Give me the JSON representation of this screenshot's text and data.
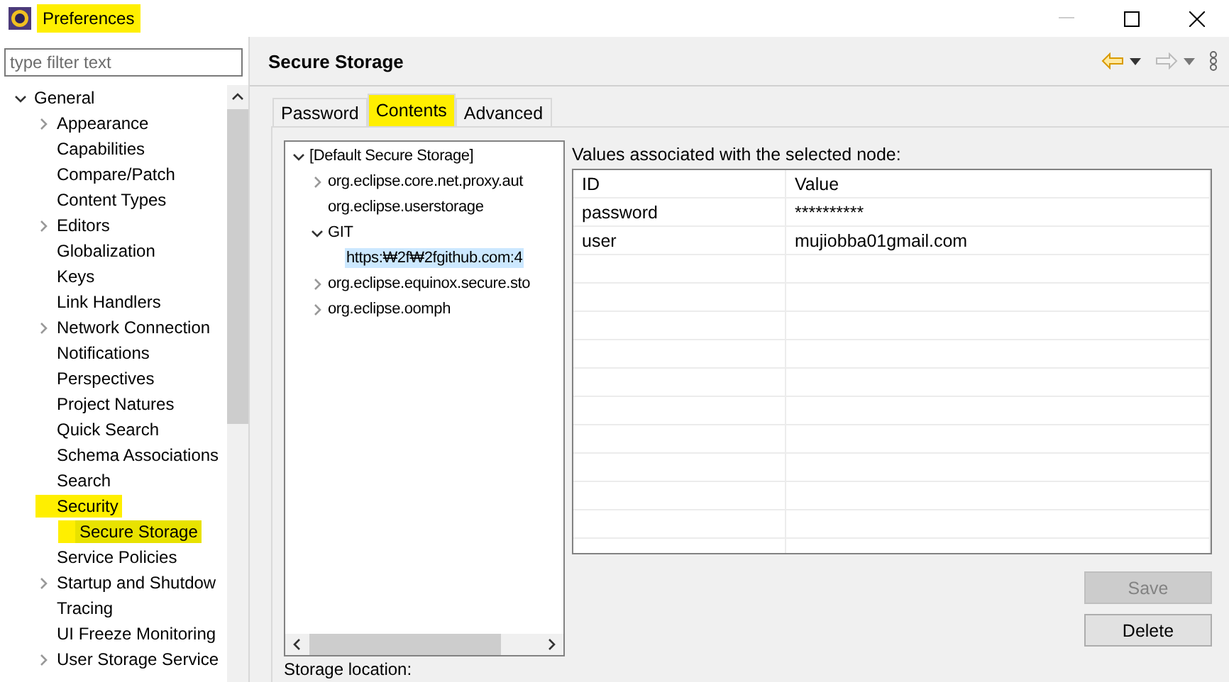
{
  "window": {
    "title": "Preferences",
    "title_highlighted": true
  },
  "filter": {
    "placeholder": "type filter text"
  },
  "nav_tree": [
    {
      "label": "General",
      "expanded": true,
      "selected": false,
      "highlighted": false,
      "children": [
        {
          "label": "Appearance",
          "expanded": false,
          "selected": false,
          "highlighted": false
        },
        {
          "label": "Capabilities",
          "selected": false,
          "highlighted": false
        },
        {
          "label": "Compare/Patch",
          "selected": false,
          "highlighted": false
        },
        {
          "label": "Content Types",
          "selected": false,
          "highlighted": false
        },
        {
          "label": "Editors",
          "expanded": false,
          "selected": false,
          "highlighted": false
        },
        {
          "label": "Globalization",
          "selected": false,
          "highlighted": false
        },
        {
          "label": "Keys",
          "selected": false,
          "highlighted": false
        },
        {
          "label": "Link Handlers",
          "selected": false,
          "highlighted": false
        },
        {
          "label": "Network Connection",
          "expanded": false,
          "selected": false,
          "highlighted": false
        },
        {
          "label": "Notifications",
          "selected": false,
          "highlighted": false
        },
        {
          "label": "Perspectives",
          "selected": false,
          "highlighted": false
        },
        {
          "label": "Project Natures",
          "selected": false,
          "highlighted": false
        },
        {
          "label": "Quick Search",
          "selected": false,
          "highlighted": false
        },
        {
          "label": "Schema Associations",
          "selected": false,
          "highlighted": false
        },
        {
          "label": "Search",
          "selected": false,
          "highlighted": false
        },
        {
          "label": "Security",
          "expanded": true,
          "selected": false,
          "highlighted": true,
          "children": [
            {
              "label": "Secure Storage",
              "selected": true,
              "highlighted": true
            }
          ]
        },
        {
          "label": "Service Policies",
          "selected": false,
          "highlighted": false
        },
        {
          "label": "Startup and Shutdow",
          "expanded": false,
          "selected": false,
          "highlighted": false
        },
        {
          "label": "Tracing",
          "selected": false,
          "highlighted": false
        },
        {
          "label": "UI Freeze Monitoring",
          "selected": false,
          "highlighted": false
        },
        {
          "label": "User Storage Service",
          "expanded": false,
          "selected": false,
          "highlighted": false
        }
      ]
    }
  ],
  "page": {
    "title": "Secure Storage",
    "back_disabled": false,
    "forward_disabled": true
  },
  "tabs": [
    {
      "label": "Password",
      "selected": false,
      "highlighted": false
    },
    {
      "label": "Contents",
      "selected": true,
      "highlighted": true
    },
    {
      "label": "Advanced",
      "selected": false,
      "highlighted": false
    }
  ],
  "storage_tree": [
    {
      "label": "[Default Secure Storage]",
      "expanded": true,
      "selected": false,
      "children": [
        {
          "label": "org.eclipse.core.net.proxy.aut",
          "expanded": false,
          "selected": false
        },
        {
          "label": "org.eclipse.userstorage",
          "selected": false
        },
        {
          "label": "GIT",
          "expanded": true,
          "selected": false,
          "children": [
            {
              "label": "https:₩2f₩2fgithub.com:4",
              "selected": true
            }
          ]
        },
        {
          "label": "org.eclipse.equinox.secure.sto",
          "expanded": false,
          "selected": false
        },
        {
          "label": "org.eclipse.oomph",
          "expanded": false,
          "selected": false
        }
      ]
    }
  ],
  "values_label": "Values associated with the selected node:",
  "table": {
    "columns": [
      "ID",
      "Value"
    ],
    "rows": [
      [
        "password",
        "**********"
      ],
      [
        "user",
        "mujiobba01gmail.com"
      ]
    ]
  },
  "buttons": [
    {
      "label": "Save",
      "disabled": true
    },
    {
      "label": "Delete",
      "disabled": false
    }
  ],
  "storage_location_label": "Storage location:"
}
